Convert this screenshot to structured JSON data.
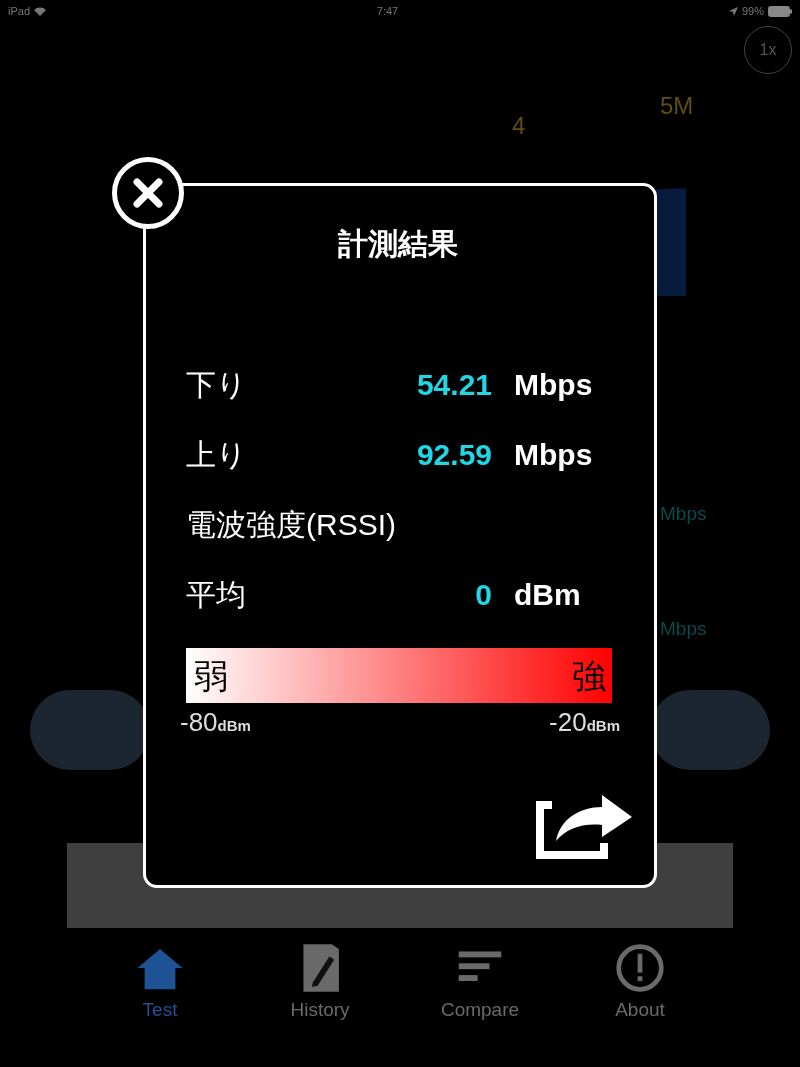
{
  "status_bar": {
    "device": "iPad",
    "time": "7:47",
    "battery": "99%"
  },
  "speed_button": "1x",
  "gauge": {
    "ticks": [
      "4",
      "5M"
    ]
  },
  "side_readings": [
    {
      "unit": "Mbps"
    },
    {
      "unit": "Mbps"
    }
  ],
  "dialog": {
    "title": "計測結果",
    "rows": [
      {
        "kind": "value",
        "label": "下り",
        "value": "54.21",
        "unit": "Mbps"
      },
      {
        "kind": "value",
        "label": "上り",
        "value": "92.59",
        "unit": "Mbps"
      },
      {
        "kind": "heading",
        "label": "電波強度(RSSI)"
      },
      {
        "kind": "value",
        "label": "平均",
        "value": "0",
        "unit": "dBm"
      }
    ],
    "scale": {
      "low_label": "弱",
      "high_label": "強",
      "min": "-80",
      "min_unit": "dBm",
      "max": "-20",
      "max_unit": "dBm"
    }
  },
  "tabs": [
    {
      "label": "Test",
      "selected": true
    },
    {
      "label": "History",
      "selected": false
    },
    {
      "label": "Compare",
      "selected": false
    },
    {
      "label": "About",
      "selected": false
    }
  ]
}
